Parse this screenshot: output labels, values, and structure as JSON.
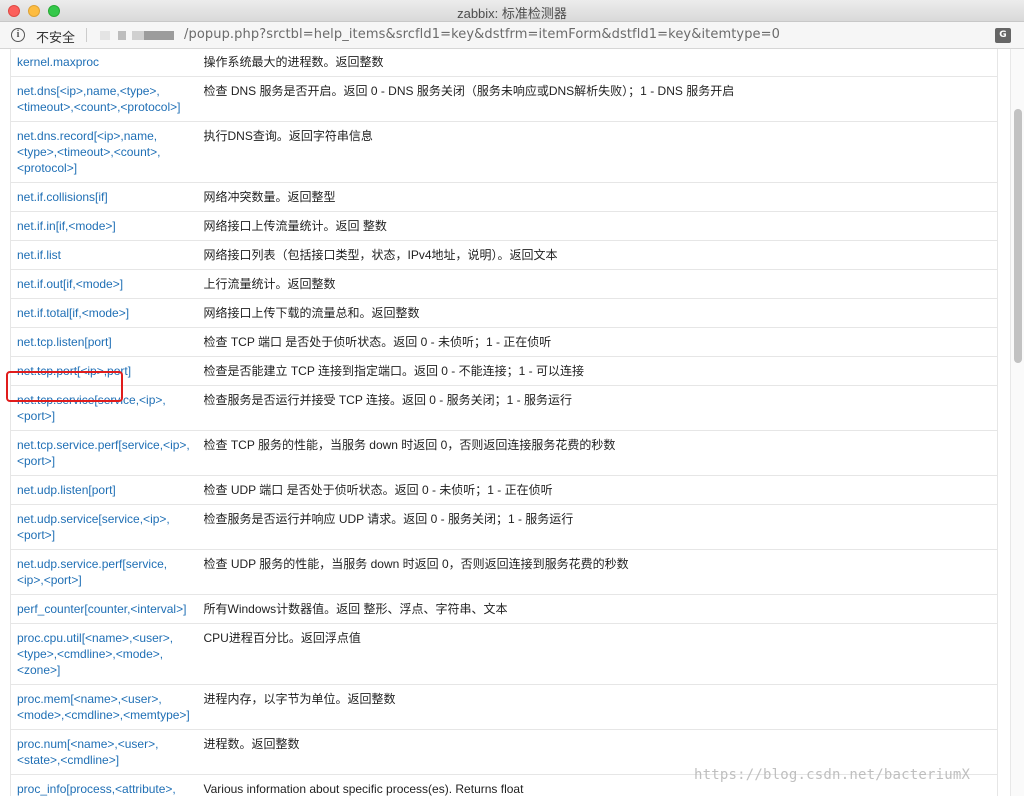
{
  "window": {
    "title": "zabbix: 标准检测器"
  },
  "addressbar": {
    "security_label": "不安全",
    "url": "/popup.php?srctbl=help_items&srcfld1=key&dstfrm=itemForm&dstfld1=key&itemtype=0"
  },
  "icons": {
    "info": "info-icon",
    "translate": "translate-icon"
  },
  "colors": {
    "link": "#1f6fb5",
    "highlight": "#e01c1c"
  },
  "items": [
    {
      "key": "kernel.maxproc",
      "desc": "操作系统最大的进程数。返回整数"
    },
    {
      "key": "net.dns[<ip>,name,<type>,<timeout>,<count>,<protocol>]",
      "desc": "检查 DNS 服务是否开启。返回 0 - DNS 服务关闭（服务未响应或DNS解析失败）；1 - DNS 服务开启"
    },
    {
      "key": "net.dns.record[<ip>,name,<type>,<timeout>,<count>,<protocol>]",
      "desc": "执行DNS查询。返回字符串信息"
    },
    {
      "key": "net.if.collisions[if]",
      "desc": "网络冲突数量。返回整型"
    },
    {
      "key": "net.if.in[if,<mode>]",
      "desc": "网络接口上传流量统计。返回 整数"
    },
    {
      "key": "net.if.list",
      "desc": "网络接口列表（包括接口类型，状态，IPv4地址，说明）。返回文本"
    },
    {
      "key": "net.if.out[if,<mode>]",
      "desc": "上行流量统计。返回整数"
    },
    {
      "key": "net.if.total[if,<mode>]",
      "desc": "网络接口上传下载的流量总和。返回整数"
    },
    {
      "key": "net.tcp.listen[port]",
      "desc": "检查 TCP 端口 是否处于侦听状态。返回 0 - 未侦听；1 - 正在侦听"
    },
    {
      "key": "net.tcp.port[<ip>,port]",
      "desc": "检查是否能建立 TCP 连接到指定端口。返回 0 - 不能连接；1 - 可以连接"
    },
    {
      "key": "net.tcp.service[service,<ip>,<port>]",
      "desc": "检查服务是否运行并接受 TCP 连接。返回 0 - 服务关闭；1 - 服务运行"
    },
    {
      "key": "net.tcp.service.perf[service,<ip>,<port>]",
      "desc": "检查 TCP 服务的性能，当服务 down 时返回 0，否则返回连接服务花费的秒数"
    },
    {
      "key": "net.udp.listen[port]",
      "desc": "检查 UDP 端口 是否处于侦听状态。返回 0 - 未侦听；1 - 正在侦听"
    },
    {
      "key": "net.udp.service[service,<ip>,<port>]",
      "desc": "检查服务是否运行并响应 UDP 请求。返回 0 - 服务关闭；1 - 服务运行"
    },
    {
      "key": "net.udp.service.perf[service,<ip>,<port>]",
      "desc": "检查 UDP 服务的性能，当服务 down 时返回 0，否则返回连接到服务花费的秒数"
    },
    {
      "key": "perf_counter[counter,<interval>]",
      "desc": "所有Windows计数器值。返回 整形、浮点、字符串、文本"
    },
    {
      "key": "proc.cpu.util[<name>,<user>,<type>,<cmdline>,<mode>,<zone>]",
      "desc": "CPU进程百分比。返回浮点值"
    },
    {
      "key": "proc.mem[<name>,<user>,<mode>,<cmdline>,<memtype>]",
      "desc": "进程内存，以字节为单位。返回整数"
    },
    {
      "key": "proc.num[<name>,<user>,<state>,<cmdline>]",
      "desc": "进程数。返回整数"
    },
    {
      "key": "proc_info[process,<attribute>,",
      "desc": "Various information about specific process(es). Returns float"
    }
  ],
  "watermark": "https://blog.csdn.net/bacteriumX"
}
